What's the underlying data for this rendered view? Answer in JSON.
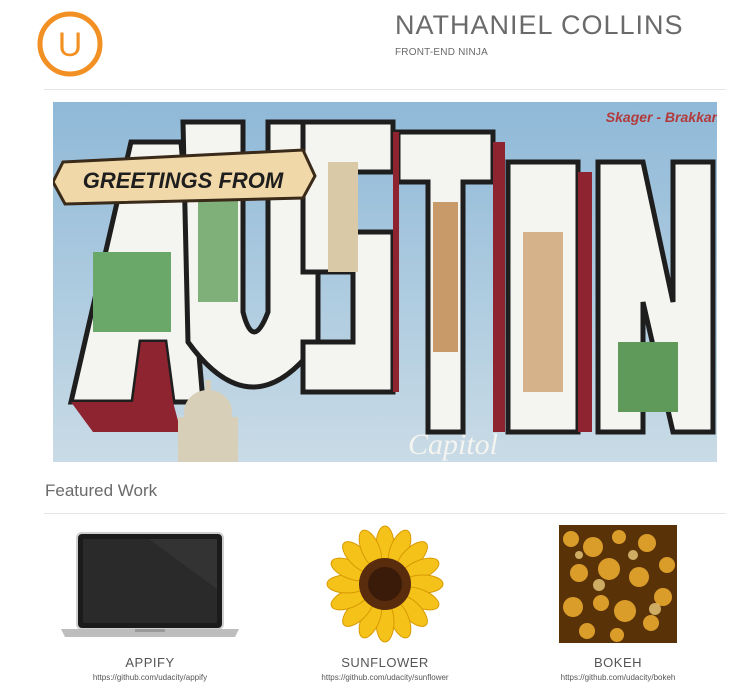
{
  "header": {
    "logo_letter": "U",
    "title": "NATHANIEL COLLINS",
    "subtitle": "FRONT-END NINJA",
    "accent_color": "#f29023"
  },
  "hero": {
    "banner_text": "GREETINGS FROM",
    "big_word": "AUSTIN",
    "corner_text": "Skager - Brakkan",
    "bottom_text": "Capitol"
  },
  "featured": {
    "title": "Featured Work",
    "items": [
      {
        "title": "APPIFY",
        "url": "https://github.com/udacity/appify",
        "icon": "laptop-icon"
      },
      {
        "title": "SUNFLOWER",
        "url": "https://github.com/udacity/sunflower",
        "icon": "sunflower-icon"
      },
      {
        "title": "BOKEH",
        "url": "https://github.com/udacity/bokeh",
        "icon": "bokeh-icon"
      }
    ]
  }
}
